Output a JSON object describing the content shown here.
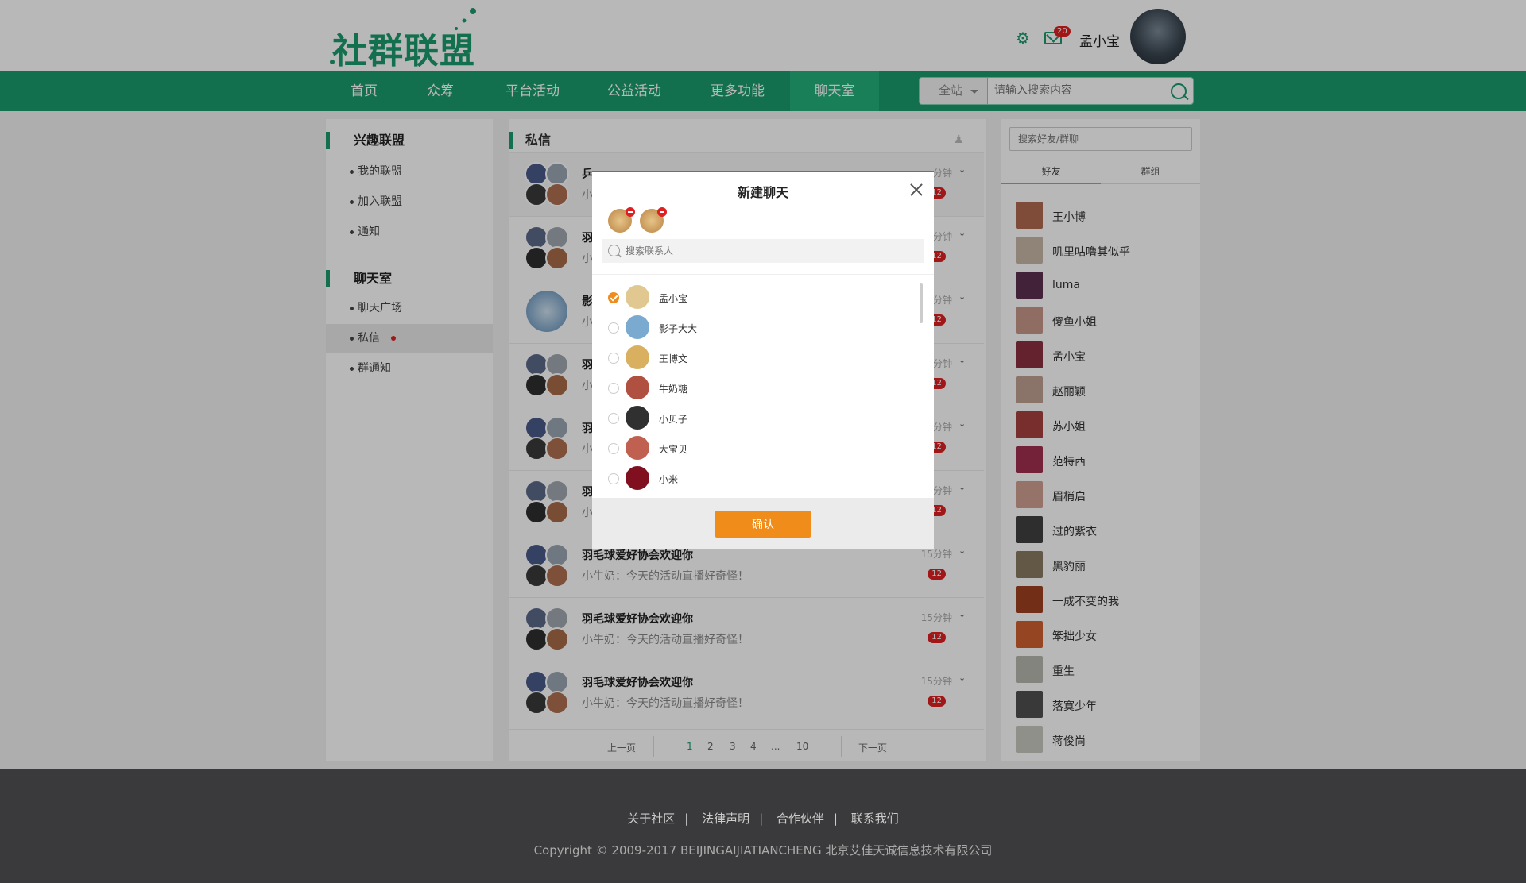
{
  "header": {
    "logo": "社群联盟",
    "mail_count": "20",
    "user_name": "孟小宝"
  },
  "nav": {
    "items": [
      {
        "label": "首页"
      },
      {
        "label": "众筹"
      },
      {
        "label": "平台活动"
      },
      {
        "label": "公益活动"
      },
      {
        "label": "更多功能"
      },
      {
        "label": "聊天室"
      }
    ],
    "active": "聊天室"
  },
  "search": {
    "scope": "全站",
    "placeholder": "请输入搜索内容"
  },
  "sidebar": {
    "interest_title": "兴趣联盟",
    "interest_links": [
      {
        "label": "我的联盟"
      },
      {
        "label": "加入联盟"
      },
      {
        "label": "通知"
      }
    ],
    "chat_title": "聊天室",
    "chat_links": [
      {
        "label": "聊天广场"
      },
      {
        "label": "私信"
      },
      {
        "label": "群通知"
      }
    ]
  },
  "pm": {
    "title": "私信",
    "rows": [
      {
        "name": "乒",
        "msg": "小",
        "time": "分钟",
        "badge": "12"
      },
      {
        "name": "羽",
        "msg": "小",
        "time": "分钟",
        "badge": "12"
      },
      {
        "name": "影",
        "msg": "小",
        "time": "分钟",
        "badge": "12"
      },
      {
        "name": "羽",
        "msg": "小",
        "time": "分钟",
        "badge": "12"
      },
      {
        "name": "羽",
        "msg": "小",
        "time": "分钟",
        "badge": "12"
      },
      {
        "name": "羽",
        "msg": "小",
        "time": "分钟",
        "badge": "12"
      },
      {
        "name": "羽毛球爱好协会欢迎你",
        "msg": "小牛奶：今天的活动直播好奇怪！",
        "time": "15分钟",
        "badge": "12"
      },
      {
        "name": "羽毛球爱好协会欢迎你",
        "msg": "小牛奶：今天的活动直播好奇怪！",
        "time": "15分钟",
        "badge": "12"
      },
      {
        "name": "羽毛球爱好协会欢迎你",
        "msg": "小牛奶：今天的活动直播好奇怪！",
        "time": "15分钟",
        "badge": "12"
      }
    ],
    "pager": {
      "prev": "上一页",
      "pages": [
        "1",
        "2",
        "3",
        "4",
        "...",
        "10"
      ],
      "next": "下一页"
    }
  },
  "friends": {
    "search_placeholder": "搜索好友/群聊",
    "tab_friends": "好友",
    "tab_groups": "群组",
    "list": [
      {
        "name": "王小博"
      },
      {
        "name": "叽里咕噜其似乎"
      },
      {
        "name": "luma"
      },
      {
        "name": "傻鱼小姐"
      },
      {
        "name": "孟小宝"
      },
      {
        "name": "赵丽颖"
      },
      {
        "name": "苏小姐"
      },
      {
        "name": "范特西"
      },
      {
        "name": "眉梢启"
      },
      {
        "name": "过的紫衣"
      },
      {
        "name": "黑豹丽"
      },
      {
        "name": "一成不变的我"
      },
      {
        "name": "笨拙少女"
      },
      {
        "name": "重生"
      },
      {
        "name": "落寞少年"
      },
      {
        "name": "蒋俊尚"
      }
    ]
  },
  "modal": {
    "title": "新建聊天",
    "search_placeholder": "搜索联系人",
    "confirm": "确认",
    "contacts": [
      {
        "name": "孟小宝",
        "checked": true
      },
      {
        "name": "影子大大",
        "checked": false
      },
      {
        "name": "王博文",
        "checked": false
      },
      {
        "name": "牛奶糖",
        "checked": false
      },
      {
        "name": "小贝子",
        "checked": false
      },
      {
        "name": "大宝贝",
        "checked": false
      },
      {
        "name": "小米",
        "checked": false
      }
    ]
  },
  "footer": {
    "links": [
      {
        "label": "关于社区"
      },
      {
        "label": "法律声明"
      },
      {
        "label": "合作伙伴"
      },
      {
        "label": "联系我们"
      }
    ],
    "copyright": "Copyright © 2009-2017 BEIJINGAIJIATIANCHENG 北京艾佳天诚信息技术有限公司"
  }
}
